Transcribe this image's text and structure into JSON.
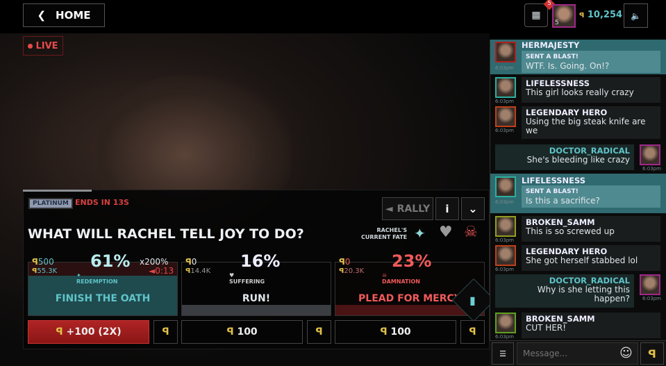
{
  "header": {
    "home_label": "HOME",
    "notification_count": "5",
    "player_level": "5",
    "balance": "10,254",
    "sound_icon": "speaker-icon",
    "gift_icon": "gift-icon"
  },
  "video": {
    "live_label": "LIVE"
  },
  "poll": {
    "tier": "PLATINUM",
    "ends": "ENDS IN 13S",
    "question": "WHAT WILL RACHEL TELL JOY TO DO?",
    "rally_label": "RALLY",
    "info_label": "i",
    "fate_label_1": "RACHEL'S",
    "fate_label_2": "CURRENT FATE",
    "options": [
      {
        "label": "FINISH THE OATH",
        "percent": "61%",
        "fate": "REDEMPTION",
        "my_bet": "500",
        "total": "55.3K",
        "multiplier": "x200%",
        "timer": "0:13",
        "bet_button": "+100 (2X)",
        "color": "#5fc4c8"
      },
      {
        "label": "RUN!",
        "percent": "16%",
        "fate": "SUFFERING",
        "my_bet": "0",
        "total": "14.4K",
        "bet_button": "100",
        "color": "#dfe6ea"
      },
      {
        "label": "PLEAD FOR MERCY",
        "percent": "23%",
        "fate": "DAMNATION",
        "my_bet": "0",
        "total": "20.3K",
        "bet_button": "100",
        "color": "#f05a5a"
      }
    ]
  },
  "colors": {
    "accent_teal": "#5fc4c8",
    "danger_red": "#d84040",
    "coin_gold": "#e0c048"
  },
  "chat": {
    "messages": [
      {
        "user": "HERMAJESTY",
        "blast": "SENT A BLAST!",
        "text": "WTF. Is. Going. On!?",
        "time": "6:03pm"
      },
      {
        "user": "LIFELESSNESS",
        "text": "This girl looks really crazy",
        "time": "6:03pm"
      },
      {
        "user": "LEGENDARY HERO",
        "text": "Using the big steak knife are we",
        "time": "6:03pm"
      },
      {
        "user": "DOCTOR_RADICAL",
        "text": "She's bleeding like crazy",
        "time": "6:03pm"
      },
      {
        "user": "LIFELESSNESS",
        "blast": "SENT A BLAST!",
        "text": "Is this a sacrifice?",
        "time": "6:03pm"
      },
      {
        "user": "BROKEN_SAMM",
        "text": "This is so screwed up",
        "time": "6:03pm"
      },
      {
        "user": "LEGENDARY HERO",
        "text": "She got herself stabbed lol",
        "time": "6:03pm"
      },
      {
        "user": "DOCTOR_RADICAL",
        "text": "Why is she letting this happen?",
        "time": "6:03pm"
      },
      {
        "user": "BROKEN_SAMM",
        "text": "CUT HER!",
        "time": "6:03pm"
      }
    ],
    "placeholder": "Message..."
  }
}
